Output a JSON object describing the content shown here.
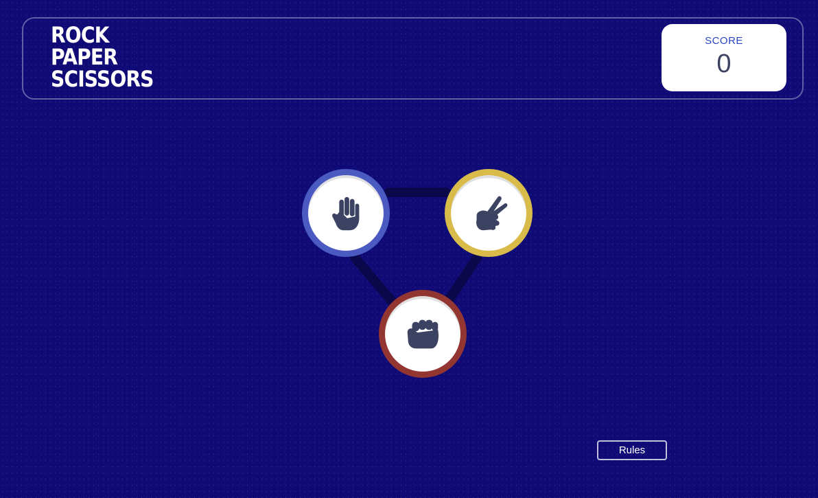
{
  "header": {
    "title_lines": [
      "ROCK",
      "PAPER",
      "SCISSORS"
    ],
    "score_label": "SCORE",
    "score_value": "0"
  },
  "choices": [
    {
      "id": "paper",
      "icon": "hand-paper-icon",
      "ring_color": "#4a5ac1"
    },
    {
      "id": "scissors",
      "icon": "hand-scissors-icon",
      "ring_color": "#d9bb4a"
    },
    {
      "id": "rock",
      "icon": "hand-rock-icon",
      "ring_color": "#933631"
    }
  ],
  "colors": {
    "background": "#0f0a75",
    "icon_fill": "#3b4262",
    "score_label": "#2a45c2"
  },
  "footer": {
    "rules_label": "Rules"
  }
}
